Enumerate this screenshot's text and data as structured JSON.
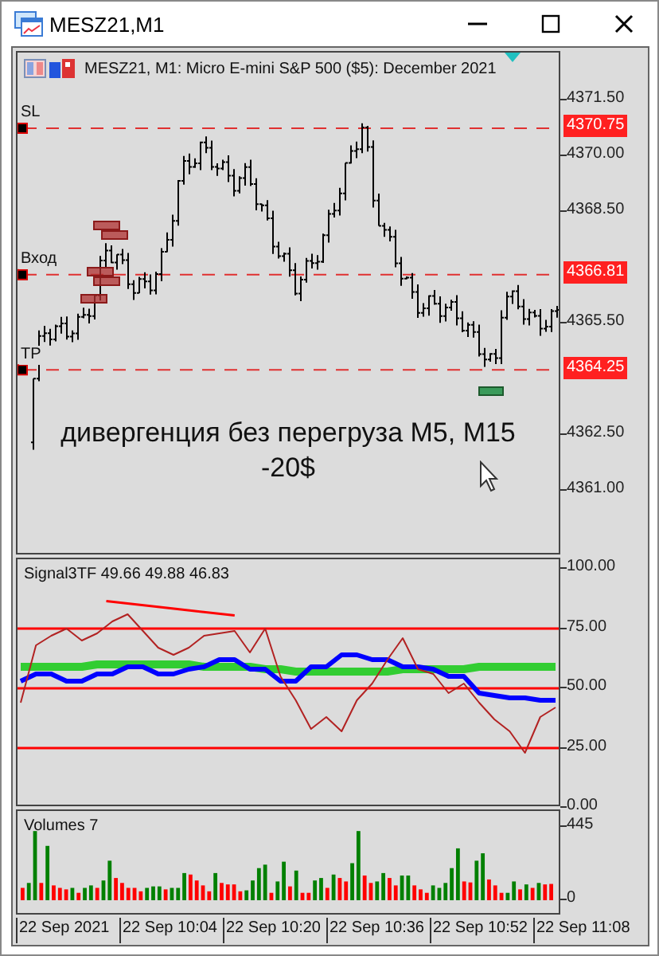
{
  "window": {
    "title": "MESZ21,M1"
  },
  "chart": {
    "title": "MESZ21, M1:  Micro E-mini S&P 500 ($5): December 2021",
    "price_ticks": [
      "4371.50",
      "4370.00",
      "4368.50",
      "4365.50",
      "4362.50",
      "4361.00"
    ],
    "levels": [
      {
        "label": "SL",
        "price": "4370.75"
      },
      {
        "label": "Вход",
        "price": "4366.81"
      },
      {
        "label": "TP",
        "price": "4364.25"
      }
    ],
    "note": [
      "дивергенция без перегруза М5, М15",
      "-20$"
    ]
  },
  "indicator": {
    "label": "Signal3TF 49.66 49.88 46.83",
    "chart_data": {
      "type": "line",
      "ylim": [
        0,
        104
      ],
      "grid": true,
      "yticks": [
        {
          "value": 100,
          "label": "100.00"
        },
        {
          "value": 75,
          "label": "75.00"
        },
        {
          "value": 50,
          "label": "50.00"
        },
        {
          "value": 25,
          "label": "25.00"
        },
        {
          "value": 0,
          "label": "0.00"
        }
      ],
      "series": [
        {
          "color": "#b22222",
          "values": [
            44,
            68,
            72,
            75,
            70,
            73,
            78,
            81,
            74,
            67,
            64,
            67,
            72,
            73,
            74,
            65,
            75,
            55,
            45,
            33,
            38,
            32,
            45,
            52,
            62,
            71,
            58,
            56,
            48,
            52,
            44,
            37,
            32,
            23,
            38,
            42
          ]
        },
        {
          "color": "#0000ff",
          "values": [
            53,
            56,
            56,
            53,
            53,
            56,
            56,
            59,
            59,
            56,
            56,
            58,
            59,
            62,
            62,
            58,
            58,
            53,
            53,
            59,
            59,
            64,
            64,
            62,
            62,
            59,
            59,
            58,
            55,
            55,
            48,
            47,
            46,
            46,
            45,
            45
          ]
        },
        {
          "color": "#32cd32",
          "values": [
            59,
            59,
            59,
            59,
            59,
            60,
            60,
            60,
            60,
            60,
            60,
            60,
            59,
            59,
            59,
            59,
            58,
            58,
            57,
            57,
            57,
            57,
            57,
            57,
            57,
            58,
            58,
            58,
            58,
            58,
            59,
            59,
            59,
            59,
            59,
            59
          ]
        }
      ]
    }
  },
  "volumes": {
    "label": "Volumes 7",
    "chart_data": {
      "type": "bar",
      "ylim": [
        0,
        445
      ],
      "yticks": [
        {
          "value": 445,
          "label": "445"
        },
        {
          "value": 0,
          "label": "0"
        }
      ],
      "stacked": true,
      "categories": [
        null,
        null,
        null,
        null,
        null,
        null,
        null,
        null,
        null,
        null,
        null,
        null,
        null,
        null,
        null,
        null,
        null,
        null,
        null,
        null,
        null,
        null,
        null,
        null,
        null,
        null,
        null,
        null,
        null,
        null,
        null,
        null,
        null,
        null,
        null,
        null,
        null,
        null,
        null,
        null,
        null,
        null,
        null,
        null,
        null,
        null,
        null,
        null,
        null,
        null,
        null,
        null,
        null,
        null,
        null,
        null,
        null,
        null,
        null,
        null,
        null,
        null,
        null,
        null,
        null,
        null,
        null,
        null,
        null,
        null,
        null,
        null,
        null,
        null,
        null,
        null,
        null,
        null,
        null,
        null,
        null,
        null,
        null,
        null,
        null,
        null
      ],
      "series": [
        {
          "color": "#008000",
          "values": [
            null,
            105,
            420,
            null,
            330,
            null,
            null,
            null,
            75,
            null,
            75,
            90,
            null,
            120,
            240,
            null,
            null,
            null,
            null,
            null,
            75,
            84,
            84,
            null,
            75,
            75,
            165,
            null,
            null,
            null,
            null,
            165,
            null,
            null,
            null,
            null,
            60,
            120,
            195,
            216,
            null,
            114,
            234,
            null,
            180,
            null,
            null,
            120,
            135,
            null,
            156,
            null,
            null,
            225,
            420,
            null,
            null,
            114,
            165,
            null,
            null,
            150,
            150,
            null,
            null,
            null,
            90,
            75,
            105,
            195,
            315,
            null,
            null,
            240,
            285,
            null,
            null,
            null,
            45,
            114,
            null,
            96,
            null,
            105,
            null,
            null
          ]
        },
        {
          "color": "#ff0000",
          "values": [
            75,
            null,
            null,
            105,
            null,
            90,
            75,
            66,
            null,
            45,
            null,
            null,
            75,
            null,
            null,
            135,
            105,
            75,
            75,
            54,
            null,
            null,
            null,
            66,
            null,
            null,
            null,
            156,
            120,
            90,
            54,
            null,
            105,
            96,
            96,
            54,
            null,
            null,
            null,
            null,
            45,
            null,
            null,
            84,
            null,
            45,
            45,
            null,
            null,
            75,
            null,
            135,
            114,
            null,
            null,
            150,
            105,
            null,
            null,
            135,
            90,
            null,
            null,
            90,
            66,
            45,
            null,
            null,
            null,
            null,
            null,
            114,
            108,
            null,
            null,
            126,
            90,
            45,
            null,
            null,
            66,
            null,
            75,
            null,
            96,
            99
          ]
        }
      ]
    }
  },
  "time_axis": [
    "22 Sep 2021",
    "22 Sep 10:04",
    "22 Sep 10:20",
    "22 Sep 10:36",
    "22 Sep 10:52",
    "22 Sep 11:08"
  ]
}
